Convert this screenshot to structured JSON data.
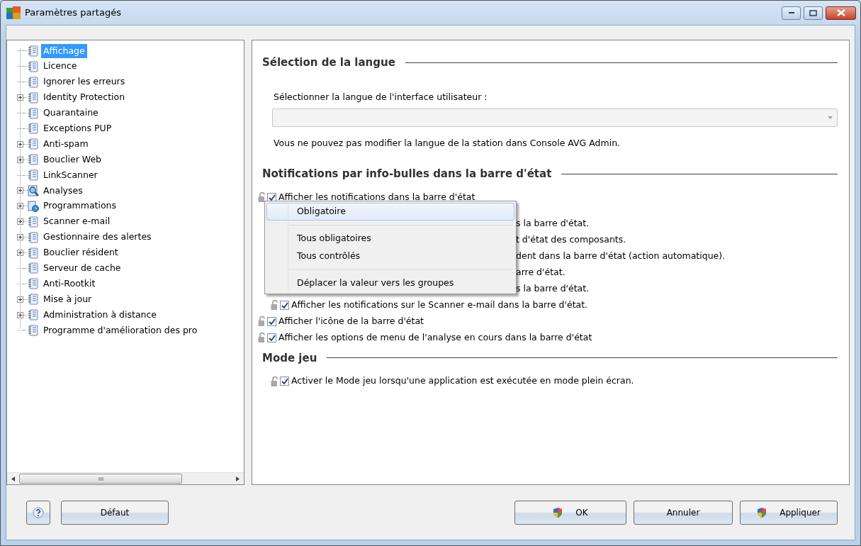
{
  "window": {
    "title": "Paramètres partagés"
  },
  "tree": {
    "items": [
      {
        "label": "Affichage",
        "selected": true,
        "expandable": false,
        "kind": "page"
      },
      {
        "label": "Licence",
        "selected": false,
        "expandable": false,
        "kind": "page"
      },
      {
        "label": "Ignorer les erreurs",
        "selected": false,
        "expandable": false,
        "kind": "page"
      },
      {
        "label": "Identity Protection",
        "selected": false,
        "expandable": true,
        "kind": "page"
      },
      {
        "label": "Quarantaine",
        "selected": false,
        "expandable": false,
        "kind": "page"
      },
      {
        "label": "Exceptions PUP",
        "selected": false,
        "expandable": false,
        "kind": "page"
      },
      {
        "label": "Anti-spam",
        "selected": false,
        "expandable": true,
        "kind": "page"
      },
      {
        "label": "Bouclier Web",
        "selected": false,
        "expandable": true,
        "kind": "page"
      },
      {
        "label": "LinkScanner",
        "selected": false,
        "expandable": false,
        "kind": "page"
      },
      {
        "label": "Analyses",
        "selected": false,
        "expandable": true,
        "kind": "scan"
      },
      {
        "label": "Programmations",
        "selected": false,
        "expandable": true,
        "kind": "schedule"
      },
      {
        "label": "Scanner e-mail",
        "selected": false,
        "expandable": true,
        "kind": "page"
      },
      {
        "label": "Gestionnaire des alertes",
        "selected": false,
        "expandable": true,
        "kind": "page"
      },
      {
        "label": "Bouclier résident",
        "selected": false,
        "expandable": true,
        "kind": "page"
      },
      {
        "label": "Serveur de cache",
        "selected": false,
        "expandable": false,
        "kind": "page"
      },
      {
        "label": "Anti-Rootkit",
        "selected": false,
        "expandable": false,
        "kind": "page"
      },
      {
        "label": "Mise à jour",
        "selected": false,
        "expandable": true,
        "kind": "page"
      },
      {
        "label": "Administration à distance",
        "selected": false,
        "expandable": true,
        "kind": "page"
      },
      {
        "label": "Programme d'amélioration des pro",
        "selected": false,
        "expandable": false,
        "kind": "page"
      }
    ]
  },
  "sections": [
    {
      "title": "Sélection de la langue",
      "kind": "language",
      "label": "Sélectionner la langue de l'interface utilisateur :",
      "select": {
        "disabled": true
      },
      "note": "Vous ne pouvez pas modifier la langue de la station dans Console AVG Admin."
    },
    {
      "title": "Notifications par info-bulles dans la barre d'état",
      "kind": "options",
      "options": [
        {
          "kind": "option",
          "label": "Afficher les notifications dans la barre d'état",
          "checked": true,
          "indent": false
        },
        {
          "kind": "fragment",
          "label": "s la barre d'état."
        },
        {
          "kind": "fragment",
          "label": "t d'état des composants."
        },
        {
          "kind": "fragment",
          "label": "dent dans la barre d'état (action automatique)."
        },
        {
          "kind": "fragment",
          "label": "arre d'état."
        },
        {
          "kind": "fragment",
          "label": "s la barre d'état."
        },
        {
          "kind": "option",
          "label": "Afficher les notifications sur le Scanner e-mail dans la barre d'état.",
          "checked": true,
          "indent": true
        },
        {
          "kind": "option",
          "label": "Afficher l'icône de la barre d'état",
          "checked": true,
          "indent": false
        },
        {
          "kind": "option",
          "label": "Afficher les options de menu de l'analyse en cours dans la barre d'état",
          "checked": true,
          "indent": false
        }
      ]
    },
    {
      "title": "Mode jeu",
      "kind": "options",
      "options": [
        {
          "kind": "option",
          "label": "Activer le Mode jeu lorsqu'une application est exécutée en mode plein écran.",
          "checked": true,
          "indent": true
        }
      ]
    }
  ],
  "context_menu": {
    "items": [
      {
        "kind": "item",
        "label": "Obligatoire",
        "selected": true
      },
      {
        "kind": "separator"
      },
      {
        "kind": "item",
        "label": "Tous obligatoires",
        "selected": false
      },
      {
        "kind": "item",
        "label": "Tous contrôlés",
        "selected": false
      },
      {
        "kind": "separator"
      },
      {
        "kind": "item",
        "label": "Déplacer la valeur vers les groupes",
        "selected": false
      }
    ]
  },
  "footer": {
    "left_buttons": [
      {
        "label": "Défaut",
        "shield": false
      }
    ],
    "right_buttons": [
      {
        "label": "OK",
        "shield": true
      },
      {
        "label": "Annuler",
        "shield": false
      },
      {
        "label": "Appliquer",
        "shield": true
      }
    ]
  }
}
